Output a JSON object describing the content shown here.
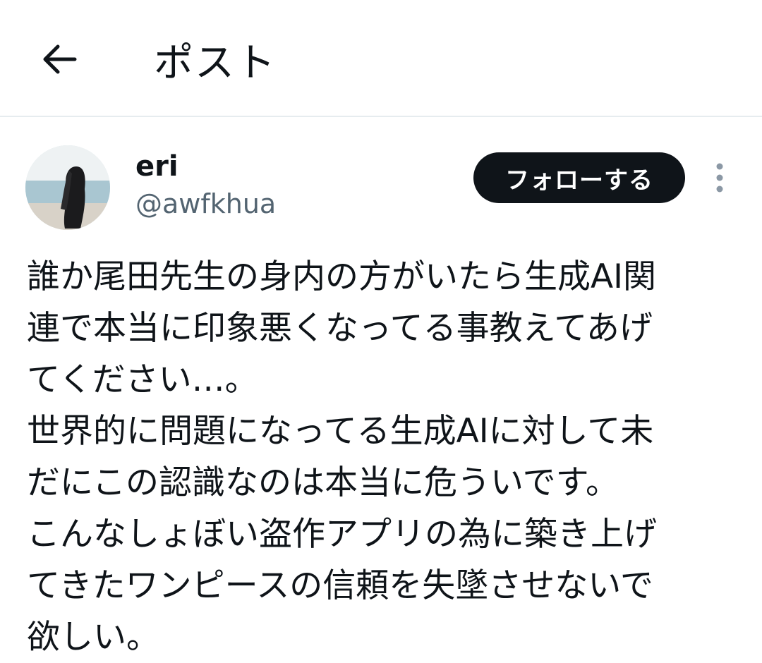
{
  "header": {
    "title": "ポスト",
    "back_icon": "arrow-left-icon"
  },
  "post": {
    "author": {
      "display_name": "eri",
      "handle": "@awfkhua"
    },
    "follow_label": "フォローする",
    "more_icon": "more-vertical-icon",
    "text": "誰か尾田先生の身内の方がいたら生成AI関\n連で本当に印象悪くなってる事教えてあげ\nてください…。\n世界的に問題になってる生成AIに対して未\nだにこの認識なのは本当に危ういです。\nこんなしょぼい盗作アプリの為に築き上げ\nてきたワンピースの信頼を失墜させないで\n欲しい。"
  },
  "colors": {
    "text": "#0f1419",
    "secondary": "#536471",
    "button_bg": "#0f1419",
    "divider": "#e6ecef"
  }
}
